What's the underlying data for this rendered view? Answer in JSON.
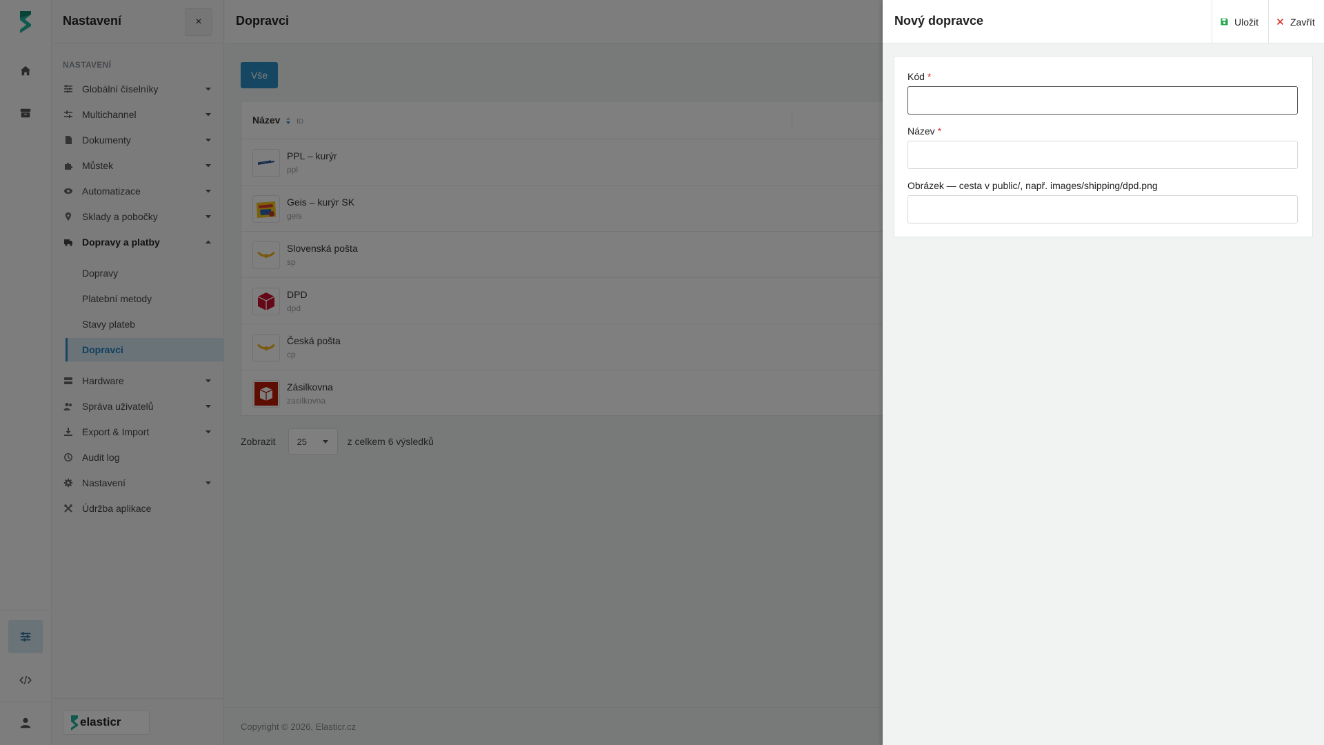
{
  "colors": {
    "accent": "#2b8cc4",
    "brand": "#1eb39a",
    "required": "#d9342b",
    "save_icon": "#2aa84f",
    "close_icon": "#d9342b"
  },
  "rail": {
    "icons": [
      "logo-icon",
      "home-icon",
      "archive-icon",
      "sliders-icon",
      "code-icon",
      "user-icon"
    ],
    "active": "sliders-icon"
  },
  "sidebar": {
    "title": "Nastavení",
    "close_label": "×",
    "section_label": "NASTAVENÍ",
    "items": [
      {
        "label": "Globální číselníky",
        "icon": "list-icon",
        "expandable": true
      },
      {
        "label": "Multichannel",
        "icon": "sliders-icon",
        "expandable": true
      },
      {
        "label": "Dokumenty",
        "icon": "document-icon",
        "expandable": true
      },
      {
        "label": "Můstek",
        "icon": "puzzle-icon",
        "expandable": true
      },
      {
        "label": "Automatizace",
        "icon": "eye-icon",
        "expandable": true
      },
      {
        "label": "Sklady a pobočky",
        "icon": "pin-icon",
        "expandable": true
      },
      {
        "label": "Dopravy a platby",
        "icon": "truck-icon",
        "expandable": true,
        "expanded": true
      },
      {
        "label": "Hardware",
        "icon": "server-icon",
        "expandable": true
      },
      {
        "label": "Správa uživatelů",
        "icon": "users-icon",
        "expandable": true
      },
      {
        "label": "Export & Import",
        "icon": "download-icon",
        "expandable": true
      },
      {
        "label": "Audit log",
        "icon": "history-icon",
        "expandable": false
      },
      {
        "label": "Nastavení",
        "icon": "gear-icon",
        "expandable": true
      },
      {
        "label": "Údržba aplikace",
        "icon": "tools-icon",
        "expandable": false
      }
    ],
    "subitems": [
      {
        "label": "Dopravy"
      },
      {
        "label": "Platební metody"
      },
      {
        "label": "Stavy plateb"
      },
      {
        "label": "Dopravci",
        "active": true
      }
    ],
    "brand": "elasticr"
  },
  "main": {
    "title": "Dopravci",
    "filter_chip": "Vše",
    "table": {
      "header_name": "Název",
      "header_id": "ID",
      "rows": [
        {
          "name": "PPL – kurýr",
          "code": "ppl",
          "logo": "ppl-logo"
        },
        {
          "name": "Geis – kurýr SK",
          "code": "geis",
          "logo": "geis-logo"
        },
        {
          "name": "Slovenská pošta",
          "code": "sp",
          "logo": "posthorn-logo"
        },
        {
          "name": "DPD",
          "code": "dpd",
          "logo": "dpd-logo"
        },
        {
          "name": "Česká pošta",
          "code": "cp",
          "logo": "posthorn-logo"
        },
        {
          "name": "Zásilkovna",
          "code": "zasilkovna",
          "logo": "zasilkovna-logo"
        }
      ]
    },
    "pager": {
      "show_label": "Zobrazit",
      "page_size": "25",
      "total_text": "z celkem 6 výsledků"
    },
    "copyright": "Copyright © 2026, Elasticr.cz"
  },
  "drawer": {
    "title": "Nový dopravce",
    "save_label": "Uložit",
    "close_label": "Zavřít",
    "fields": [
      {
        "label": "Kód",
        "required": true,
        "value": "",
        "focused": true
      },
      {
        "label": "Název",
        "required": true,
        "value": ""
      },
      {
        "label": "Obrázek — cesta v public/, např. images/shipping/dpd.png",
        "required": false,
        "value": ""
      }
    ],
    "required_mark": "*"
  }
}
